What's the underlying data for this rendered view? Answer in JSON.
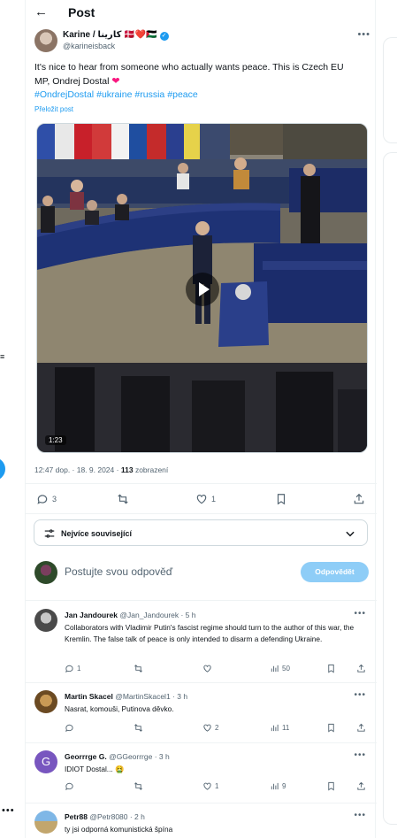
{
  "header": {
    "title": "Post"
  },
  "post": {
    "author_name": "Karine / كارينا 🇩🇰❤️🇵🇸",
    "author_handle": "@karineisback",
    "text_line1": "It's nice to hear from someone who actually wants peace. This is Czech EU",
    "text_line2": "MP, Ondrej Dostal",
    "hashtags": [
      "#OndrejDostal",
      "#ukraine",
      "#russia",
      "#peace"
    ],
    "translate_label": "Přeložit post",
    "video_duration": "1:23",
    "time": "12:47 dop. · 18. 9. 2024 ·",
    "views": "113",
    "views_label": "zobrazení",
    "reply_count": "3",
    "like_count": "1"
  },
  "filter": {
    "label": "Nejvíce související"
  },
  "compose": {
    "placeholder": "Postujte svou odpověď",
    "button": "Odpovědět"
  },
  "replies": [
    {
      "name": "Jan Jandourek",
      "handle": "@Jan_Jandourek · 5 h",
      "text": "Collaborators with Vladimir Putin's fascist regime should turn to the author of this war, the Kremlin. The false talk of peace is only intended to disarm a defending Ukraine.",
      "replies": "1",
      "reposts": "",
      "likes": "",
      "views": "50"
    },
    {
      "name": "Martin Skacel",
      "handle": "@MartinSkacel1 · 3 h",
      "text": "Nasrat, komouši, Putinova děvko.",
      "replies": "",
      "reposts": "",
      "likes": "2",
      "views": "11"
    },
    {
      "name": "Georrrge G.",
      "handle": "@GGeorrrge · 3 h",
      "text": "IDIOT Dostal... 🤮",
      "replies": "",
      "reposts": "",
      "likes": "1",
      "views": "9",
      "avatar_letter": "G"
    },
    {
      "name": "Petr88",
      "handle": "@Petr8080 · 2 h",
      "text": "ty jsi odporná komunistická špína",
      "replies": "",
      "reposts": "",
      "likes": "",
      "views": ""
    }
  ],
  "colors": {
    "accent": "#1d9bf0",
    "text": "#0f1419",
    "muted": "#536471",
    "like": "#f91880"
  }
}
